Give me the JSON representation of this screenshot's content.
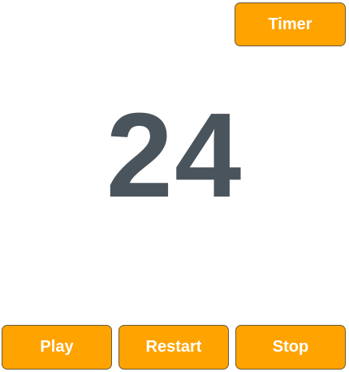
{
  "header": {
    "timer_label": "Timer"
  },
  "display": {
    "counter_value": "24"
  },
  "controls": {
    "play_label": "Play",
    "restart_label": "Restart",
    "stop_label": "Stop"
  },
  "colors": {
    "button_background": "#ffa300",
    "button_text": "#ffffff",
    "counter_text": "#4a545c",
    "page_background": "#ffffff"
  }
}
